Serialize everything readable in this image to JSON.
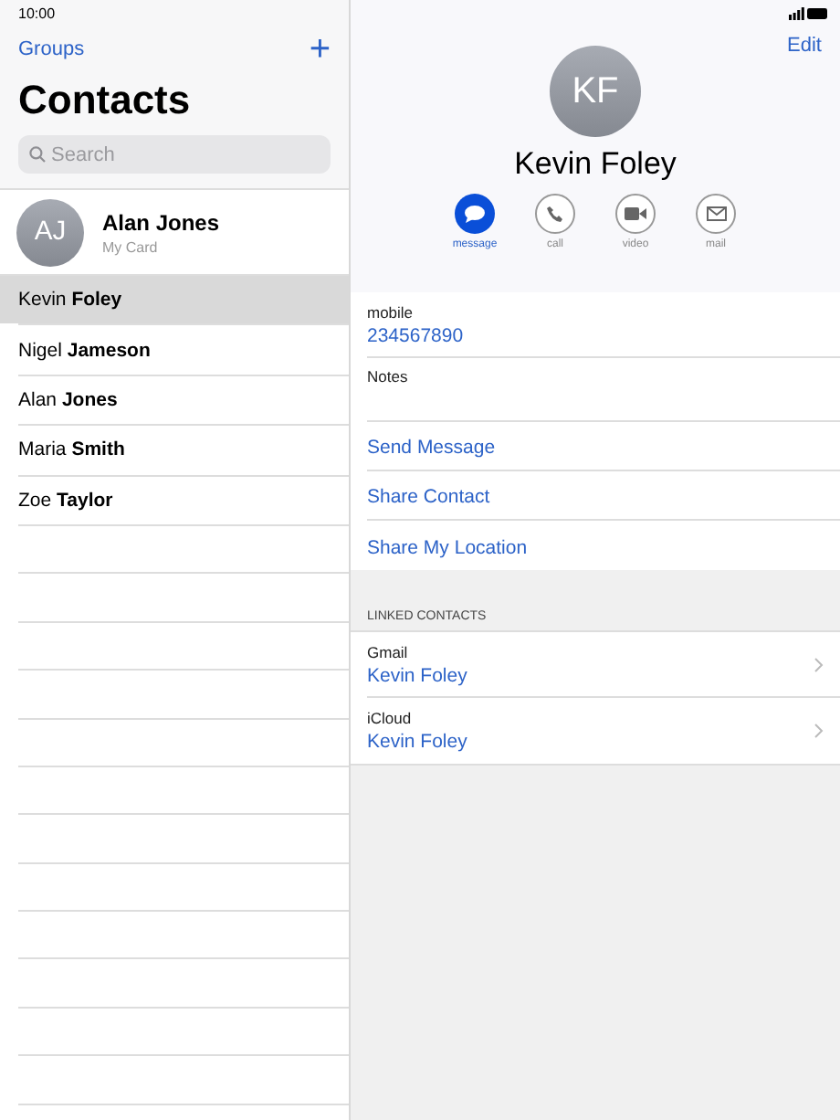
{
  "status_bar": {
    "time": "10:00"
  },
  "sidebar": {
    "groups_button": "Groups",
    "add_button": "+",
    "title": "Contacts",
    "search": {
      "placeholder": "Search"
    },
    "my_card": {
      "initials": "AJ",
      "name": "Alan Jones",
      "subtitle": "My Card"
    },
    "contacts": [
      {
        "name": "Kevin **Foley**",
        "selected": true
      },
      {
        "name": "Nigel **Jameson**",
        "selected": false
      },
      {
        "name": "Alan **Jones**",
        "selected": false
      },
      {
        "name": "Maria **Smith**",
        "selected": false
      },
      {
        "name": "Zoe **Taylor**",
        "selected": false
      }
    ]
  },
  "detail": {
    "edit_button": "Edit",
    "initials": "KF",
    "name": "Kevin Foley",
    "actions": [
      {
        "kind": "message",
        "label": "message",
        "selected": true
      },
      {
        "kind": "call",
        "label": "call",
        "selected": false
      },
      {
        "kind": "video",
        "label": "video",
        "selected": false
      },
      {
        "kind": "mail",
        "label": "mail",
        "selected": false
      }
    ],
    "phone": {
      "label": "mobile",
      "value": "234567890"
    },
    "notes": {
      "label": "Notes"
    },
    "links": [
      "Send Message",
      "Share Contact",
      "Share My Location"
    ],
    "linked_header": "LINKED CONTACTS",
    "linked": [
      {
        "source": "Gmail",
        "name": "Kevin Foley"
      },
      {
        "source": "iCloud",
        "name": "Kevin Foley"
      }
    ]
  }
}
